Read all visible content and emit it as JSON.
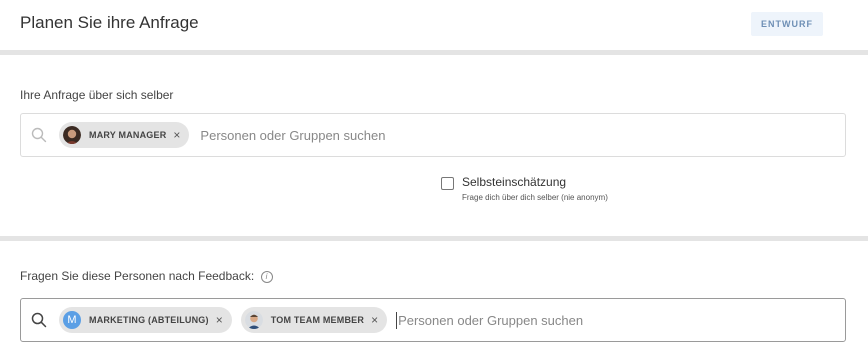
{
  "header": {
    "title": "Planen Sie ihre Anfrage",
    "status": "ENTWURF"
  },
  "self_section": {
    "label": "Ihre Anfrage über sich selber",
    "chips": [
      {
        "label": "MARY MANAGER",
        "remove": "×"
      }
    ],
    "placeholder": "Personen oder Gruppen suchen",
    "self_assessment": {
      "label": "Selbsteinschätzung",
      "hint": "Frage dich über dich selber (nie anonym)",
      "checked": false
    }
  },
  "feedback_section": {
    "label": "Fragen Sie diese Personen nach Feedback:",
    "info_glyph": "i",
    "chips": [
      {
        "label": "MARKETING (ABTEILUNG)",
        "avatar_letter": "M",
        "remove": "×"
      },
      {
        "label": "TOM TEAM MEMBER",
        "remove": "×"
      }
    ],
    "placeholder": "Personen oder Gruppen suchen"
  },
  "colors": {
    "badge_bg": "#eef4fb",
    "badge_text": "#6e8fb5",
    "chip_bg": "#e4e4e4",
    "group_avatar": "#5b9fe5"
  }
}
